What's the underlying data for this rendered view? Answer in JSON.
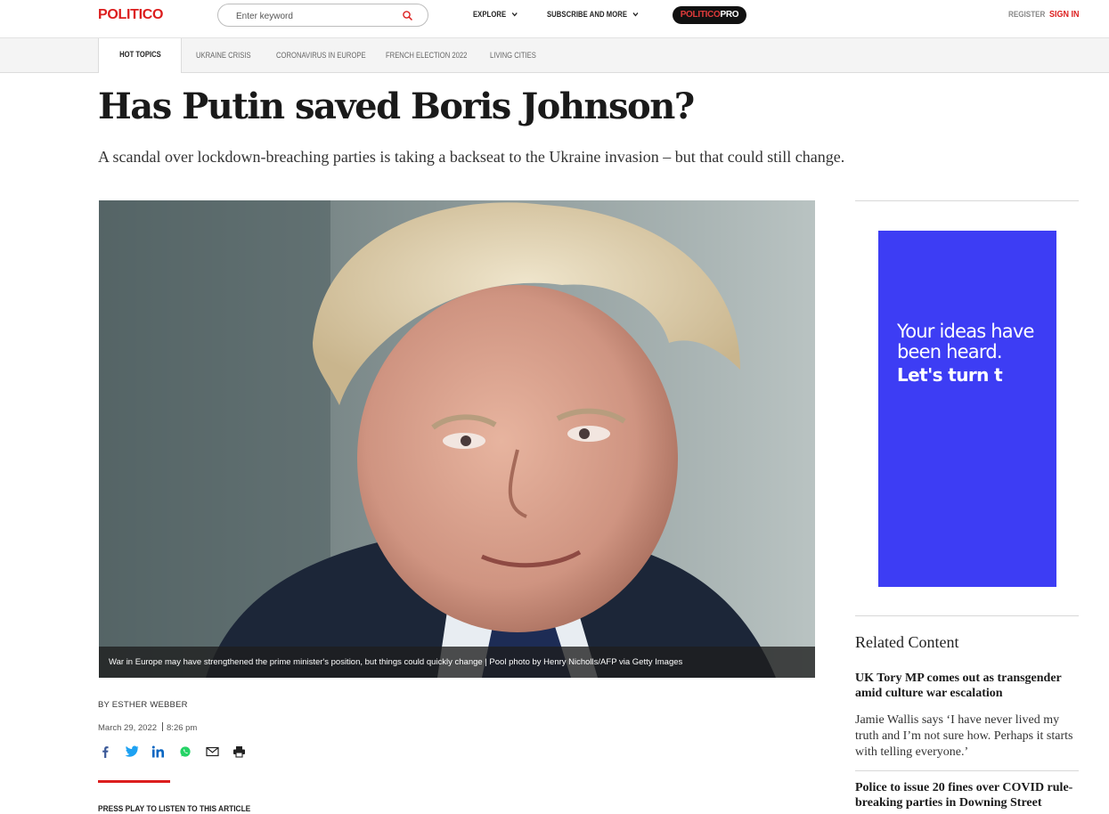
{
  "header": {
    "logo": "POLITICO",
    "search_placeholder": "Enter keyword",
    "explore": "EXPLORE",
    "subscribe": "SUBSCRIBE AND MORE",
    "pro_part1": "POLITICO",
    "pro_part2": "PRO",
    "register": "REGISTER",
    "signin": "SIGN IN"
  },
  "topics": {
    "label": "HOT TOPICS",
    "items": [
      "UKRAINE CRISIS",
      "CORONAVIRUS IN EUROPE",
      "FRENCH ELECTION 2022",
      "LIVING CITIES"
    ]
  },
  "article": {
    "headline": "Has Putin saved Boris Johnson?",
    "dek": "A scandal over lockdown-breaching parties is taking a backseat to the Ukraine invasion – but that could still change.",
    "caption": "War in Europe may have strengthened the prime minister's position, but things could quickly change | Pool photo by Henry Nicholls/AFP via Getty Images",
    "byline": "BY ESTHER WEBBER",
    "date": "March 29, 2022",
    "time": "8:26 pm",
    "listen": "PRESS PLAY TO LISTEN TO THIS ARTICLE"
  },
  "share_icons": [
    "facebook-icon",
    "twitter-icon",
    "linkedin-icon",
    "whatsapp-icon",
    "email-icon",
    "print-icon"
  ],
  "ad": {
    "line1": "Your ideas have",
    "line2": "been heard.",
    "line3": "Let's turn t",
    "bg": "#3d3df4"
  },
  "related": {
    "title": "Related Content",
    "items": [
      {
        "headline": "UK Tory MP comes out as transgender amid culture war escalation",
        "summary": "Jamie Wallis says ‘I have never lived my truth and I’m not sure how. Perhaps it starts with telling everyone.’"
      },
      {
        "headline": "Police to issue 20 fines over COVID rule-breaking parties in Downing Street"
      }
    ]
  },
  "colors": {
    "brand_red": "#dc1e1e",
    "ad_blue": "#3d3df4"
  }
}
